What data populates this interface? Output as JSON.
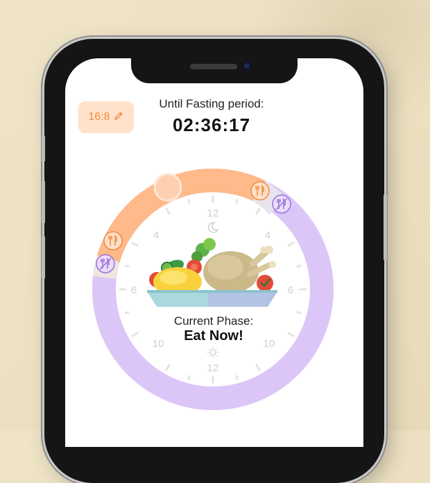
{
  "plan": {
    "label": "16:8",
    "edit_icon": "pencil-icon"
  },
  "countdown": {
    "label": "Until Fasting period:",
    "time": "02:36:17"
  },
  "clock": {
    "hour_labels": [
      "12",
      "4",
      "6",
      "10",
      "12",
      "10",
      "6",
      "4"
    ],
    "night_icon": "moon-icon",
    "day_icon": "sun-icon",
    "eating_color": "#ffb98a",
    "fasting_color": "#dcc6f8",
    "marker_eat_icon": "fork-knife-icon",
    "marker_fast_icon": "no-food-icon"
  },
  "phase": {
    "label": "Current Phase:",
    "value": "Eat Now!"
  }
}
